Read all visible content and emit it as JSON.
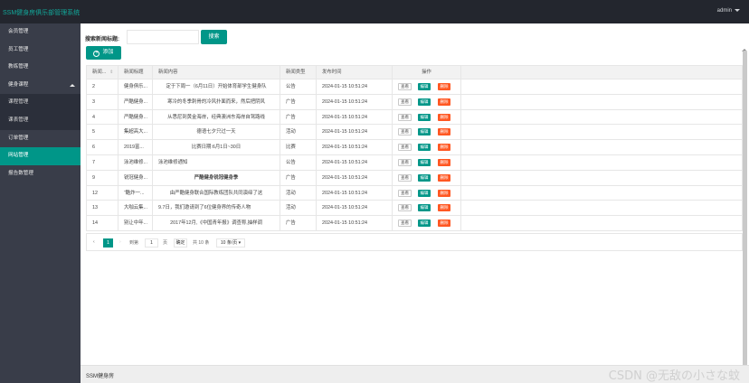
{
  "app_title": "SSM健身房俱乐部管理系统",
  "user": {
    "name": "admin"
  },
  "sidebar": {
    "items": [
      {
        "label": "会员管理"
      },
      {
        "label": "员工管理"
      },
      {
        "label": "教练管理"
      },
      {
        "label": "健身课程"
      },
      {
        "label": "课程管理"
      },
      {
        "label": "课表管理"
      },
      {
        "label": "订单管理"
      },
      {
        "label": "网站管理"
      },
      {
        "label": "报告数管理"
      }
    ]
  },
  "search": {
    "label": "搜索新闻标题:",
    "value": "",
    "placeholder": "",
    "button": "搜索"
  },
  "toolbar": {
    "add_label": "添加"
  },
  "table": {
    "headers": [
      "新闻...",
      "新闻标题",
      "新闻内容",
      "新闻类型",
      "发布时间",
      "操作"
    ],
    "op_labels": {
      "view": "查看",
      "edit": "编辑",
      "delete": "删除"
    },
    "rows": [
      {
        "id": "2",
        "title": "健身俱乐...",
        "content": "定于下周一（6月11日）开始体育部学生健身队",
        "type": "公告",
        "time": "2024-01-15 10:51:24"
      },
      {
        "id": "3",
        "title": "严酷健身...",
        "content": "寒冷的冬季刺骨的冷风扑面而来，然后把阴风",
        "type": "广告",
        "time": "2024-01-15 10:51:24"
      },
      {
        "id": "4",
        "title": "严酷健身...",
        "content": "从悉尼到黄金海岸，经典澳洲东海岸自驾路线",
        "type": "广告",
        "time": "2024-01-15 10:51:24"
      },
      {
        "id": "5",
        "title": "集超高大...",
        "content": "德语七夕只过一天",
        "type": "活动",
        "time": "2024-01-15 10:51:24"
      },
      {
        "id": "6",
        "title": "2019富...",
        "content": "比赛日期:6月1日~30日",
        "type": "比赛",
        "time": "2024-01-15 10:51:24"
      },
      {
        "id": "7",
        "title": "泳池维修...",
        "content": "泳池维修通知",
        "type": "公告",
        "time": "2024-01-15 10:51:24"
      },
      {
        "id": "9",
        "title": "锐冠健身...",
        "content": "严酷健身锐冠健身季",
        "type": "广告",
        "time": "2024-01-15 10:51:24"
      },
      {
        "id": "12",
        "title": "“酷炸一...",
        "content": "由严酷健身联合国际教练团队共同演绎了这",
        "type": "活动",
        "time": "2024-01-15 10:51:24"
      },
      {
        "id": "13",
        "title": "大咖云集...",
        "content": "9.7日，我们邀请到了6位健身界的传奇人物",
        "type": "活动",
        "time": "2024-01-15 10:51:24"
      },
      {
        "id": "14",
        "title": "别让中年...",
        "content": "2017年12月,《中国青年报》调查称,抽样调",
        "type": "广告",
        "time": "2024-01-15 10:51:24"
      }
    ]
  },
  "pager": {
    "current": "1",
    "goto_label": "到第",
    "goto_value": "1",
    "page_label": "页",
    "confirm_label": "确定",
    "total_label": "共 10 条",
    "size_label": "10 条/页"
  },
  "footer": {
    "text": "SSM健身房",
    "watermark": "CSDN @无敌の小さな蚊"
  }
}
